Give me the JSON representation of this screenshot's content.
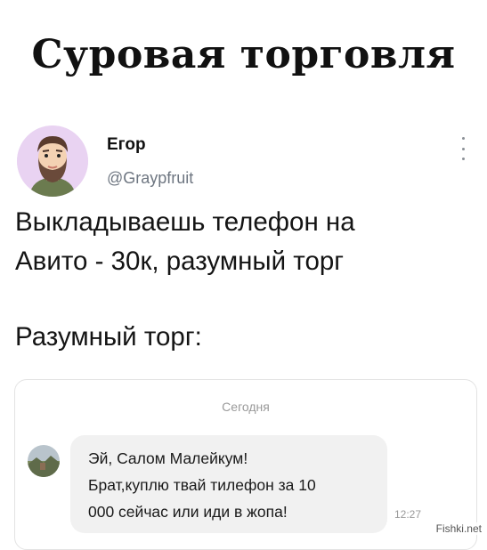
{
  "meme": {
    "title": "Суровая торговля"
  },
  "tweet": {
    "author_name": "Егор",
    "author_handle": "@Graypfruit",
    "text_lines": [
      "Выкладываешь телефон на",
      "Авито - 30к, разумный торг",
      "Разумный торг:"
    ],
    "more_icon": "vertical-ellipsis-icon",
    "avatar_icon": "bearded-man-cartoon-avatar"
  },
  "chat": {
    "date_label": "Сегодня",
    "message_lines": [
      "Эй, Салом Малейкум!",
      "Брат,куплю твай тилефон за 10",
      "000 сейчас или иди в жопа!"
    ],
    "time": "12:27",
    "sender_avatar_icon": "landscape-photo-avatar"
  },
  "watermark": "Fishki.net",
  "colors": {
    "avatar_bg": "#e9d3f2",
    "bubble_bg": "#f1f1f1",
    "handle_gray": "#6e7681"
  }
}
